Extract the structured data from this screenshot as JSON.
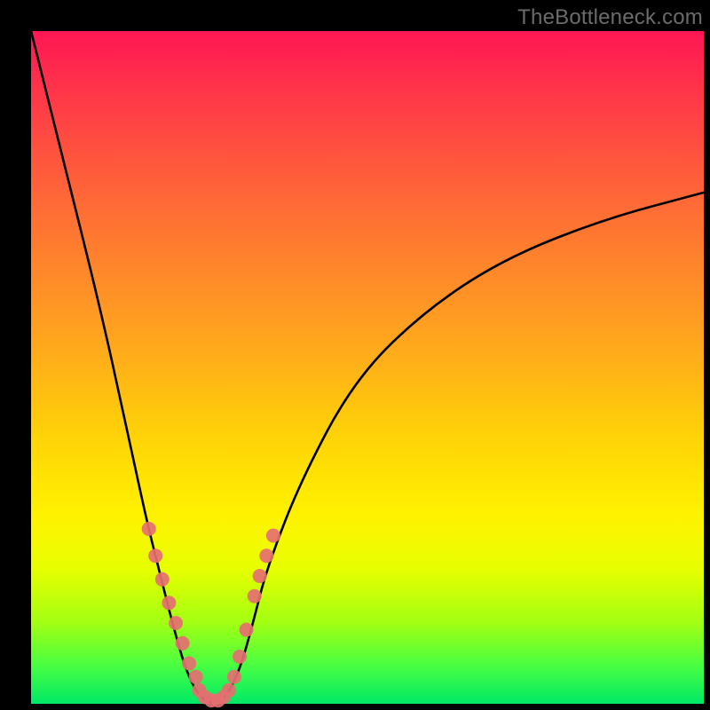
{
  "watermark": "TheBottleneck.com",
  "chart_data": {
    "type": "line",
    "title": "",
    "xlabel": "",
    "ylabel": "",
    "x_range": [
      0,
      100
    ],
    "y_range": [
      0,
      100
    ],
    "curve": {
      "description": "V-shaped bottleneck curve; two descending branches meeting at a flat minimum near x≈25–28",
      "points": [
        {
          "x": 0,
          "y": 100
        },
        {
          "x": 5,
          "y": 80
        },
        {
          "x": 10,
          "y": 60
        },
        {
          "x": 14,
          "y": 42
        },
        {
          "x": 17,
          "y": 28
        },
        {
          "x": 19,
          "y": 20
        },
        {
          "x": 21,
          "y": 12
        },
        {
          "x": 23,
          "y": 5
        },
        {
          "x": 25,
          "y": 1
        },
        {
          "x": 27,
          "y": 0
        },
        {
          "x": 29,
          "y": 1
        },
        {
          "x": 31,
          "y": 5
        },
        {
          "x": 33,
          "y": 12
        },
        {
          "x": 35,
          "y": 20
        },
        {
          "x": 40,
          "y": 33
        },
        {
          "x": 48,
          "y": 48
        },
        {
          "x": 58,
          "y": 58
        },
        {
          "x": 70,
          "y": 66
        },
        {
          "x": 85,
          "y": 72
        },
        {
          "x": 100,
          "y": 76
        }
      ]
    },
    "markers": {
      "color": "#e56f71",
      "radius_px": 8,
      "points": [
        {
          "x": 17.5,
          "y": 26
        },
        {
          "x": 18.5,
          "y": 22
        },
        {
          "x": 19.5,
          "y": 18.5
        },
        {
          "x": 20.5,
          "y": 15
        },
        {
          "x": 21.5,
          "y": 12
        },
        {
          "x": 22.5,
          "y": 9
        },
        {
          "x": 23.5,
          "y": 6
        },
        {
          "x": 24.5,
          "y": 4
        },
        {
          "x": 25.0,
          "y": 2
        },
        {
          "x": 25.8,
          "y": 1
        },
        {
          "x": 26.8,
          "y": 0.5
        },
        {
          "x": 27.8,
          "y": 0.5
        },
        {
          "x": 28.6,
          "y": 1
        },
        {
          "x": 29.4,
          "y": 2
        },
        {
          "x": 30.2,
          "y": 4
        },
        {
          "x": 31.0,
          "y": 7
        },
        {
          "x": 32.0,
          "y": 11
        },
        {
          "x": 33.2,
          "y": 16
        },
        {
          "x": 34.0,
          "y": 19
        },
        {
          "x": 35.0,
          "y": 22
        },
        {
          "x": 36.0,
          "y": 25
        }
      ]
    }
  }
}
